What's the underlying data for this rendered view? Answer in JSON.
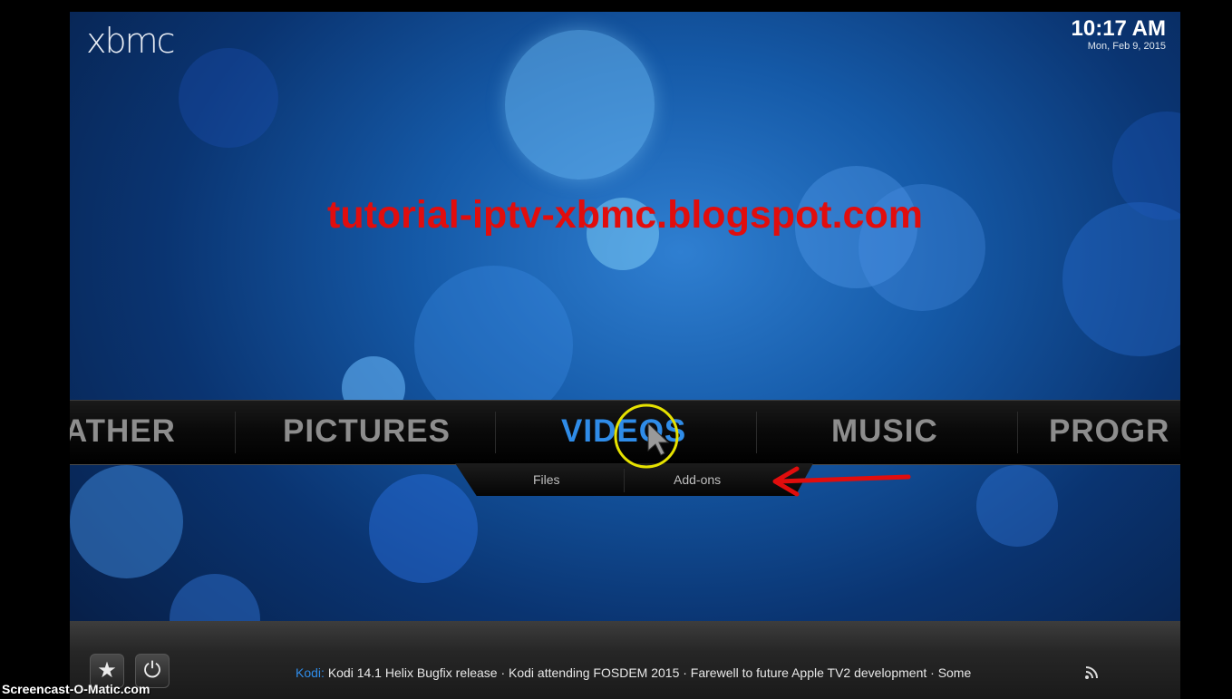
{
  "app": {
    "logo": "xbmc"
  },
  "clock": {
    "time": "10:17 AM",
    "date": "Mon, Feb 9, 2015"
  },
  "watermark": "tutorial-iptv-xbmc.blogspot.com",
  "menu": {
    "items": [
      "ATHER",
      "PICTURES",
      "VIDEOS",
      "MUSIC",
      "PROGR"
    ],
    "active": "VIDEOS"
  },
  "submenu": {
    "items": [
      "Files",
      "Add-ons"
    ]
  },
  "controls": {
    "favourites_icon": "star-icon",
    "power_icon": "power-icon"
  },
  "ticker": {
    "source": "Kodi:",
    "text": "Kodi 14.1 Helix Bugfix release · Kodi attending FOSDEM 2015 · Farewell to future Apple TV2 development · Some"
  },
  "overlay": {
    "recorder": "Screencast-O-Matic.com"
  },
  "colors": {
    "accent": "#2f8ce8",
    "annotation": "#e10d0d"
  }
}
